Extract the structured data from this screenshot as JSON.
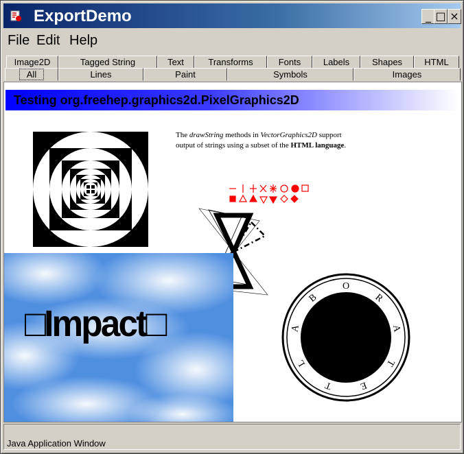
{
  "window": {
    "title": "ExportDemo",
    "controls": {
      "minimize": "_",
      "maximize": "□",
      "close": "×"
    }
  },
  "menu": [
    {
      "label": "File"
    },
    {
      "label": "Edit"
    },
    {
      "label": "Help"
    }
  ],
  "tabs_row1": [
    {
      "label": "Image2D"
    },
    {
      "label": "Tagged String"
    },
    {
      "label": "Text"
    },
    {
      "label": "Transforms"
    },
    {
      "label": "Fonts"
    },
    {
      "label": "Labels"
    },
    {
      "label": "Shapes"
    },
    {
      "label": "HTML"
    }
  ],
  "tabs_row2": [
    {
      "label": "All",
      "selected": true
    },
    {
      "label": "Lines"
    },
    {
      "label": "Paint"
    },
    {
      "label": "Symbols"
    },
    {
      "label": "Images"
    }
  ],
  "content": {
    "banner": "Testing org.freehep.graphics2d.PixelGraphics2D",
    "html_text": {
      "the": "The ",
      "draw_string": "drawString",
      "methods_in": " methods in ",
      "vector_graphics": "VectorGraphics2D",
      "support": " support",
      "line2_start": "output of strings using a subset of the ",
      "html_language": "HTML language",
      "period": "."
    },
    "impact_text": "□Impact□",
    "circle_letters": [
      "O",
      "R",
      "A",
      "T",
      "E",
      "T",
      "L",
      "A",
      "B"
    ]
  },
  "colors": {
    "symbol_red": "#ff0000",
    "banner_blue": "#0000ff"
  },
  "status": {
    "text": "Java Application Window"
  }
}
